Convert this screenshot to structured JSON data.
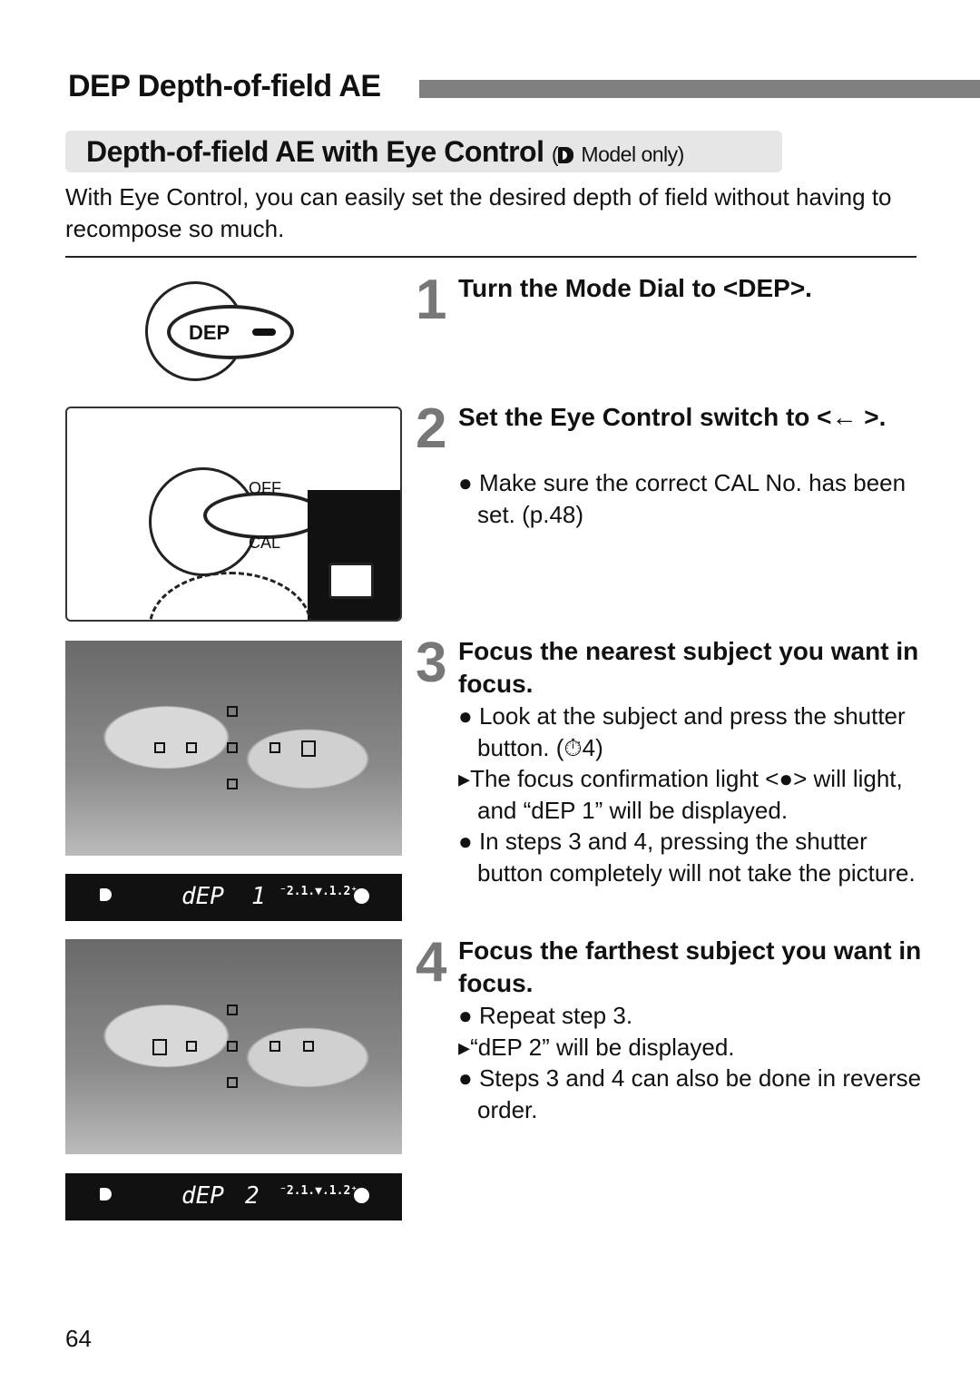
{
  "header": {
    "title": "DEP Depth-of-field AE"
  },
  "section": {
    "title": "Depth-of-field AE with Eye Control",
    "note_open": "(",
    "note": "Model only)",
    "note_icon": "eye-control-icon"
  },
  "intro": "With Eye Control, you can easily set the desired depth of field without having to recompose so much.",
  "steps": [
    {
      "num": "1",
      "title": "Turn the Mode Dial to <DEP>."
    },
    {
      "num": "2",
      "title": "Set the Eye Control switch to <← >.",
      "items": [
        "Make sure the correct CAL No. has been set. (p.48)"
      ]
    },
    {
      "num": "3",
      "title": "Focus the nearest subject you want in focus.",
      "items": [
        "Look at the subject and press the shutter button. (⏱4)",
        "The focus confirmation light <●> will light, and “dEP   1” will be displayed.",
        "In steps 3 and 4, pressing the shutter button completely will not take the picture."
      ]
    },
    {
      "num": "4",
      "title": "Focus the farthest subject you want in focus.",
      "items": [
        "Repeat step 3.",
        "“dEP   2” will be displayed.",
        "Steps 3 and 4 can also be done in reverse order."
      ]
    }
  ],
  "figures": {
    "dial_label": "DEP",
    "switch_labels": [
      "OFF",
      "CAL"
    ],
    "lcd1": {
      "text": "dEP",
      "value": "1",
      "scale": "⁻2.1.▼.1.2⁺"
    },
    "lcd2": {
      "text": "dEP",
      "value": "2",
      "scale": "⁻2.1.▼.1.2⁺"
    }
  },
  "page_number": "64"
}
